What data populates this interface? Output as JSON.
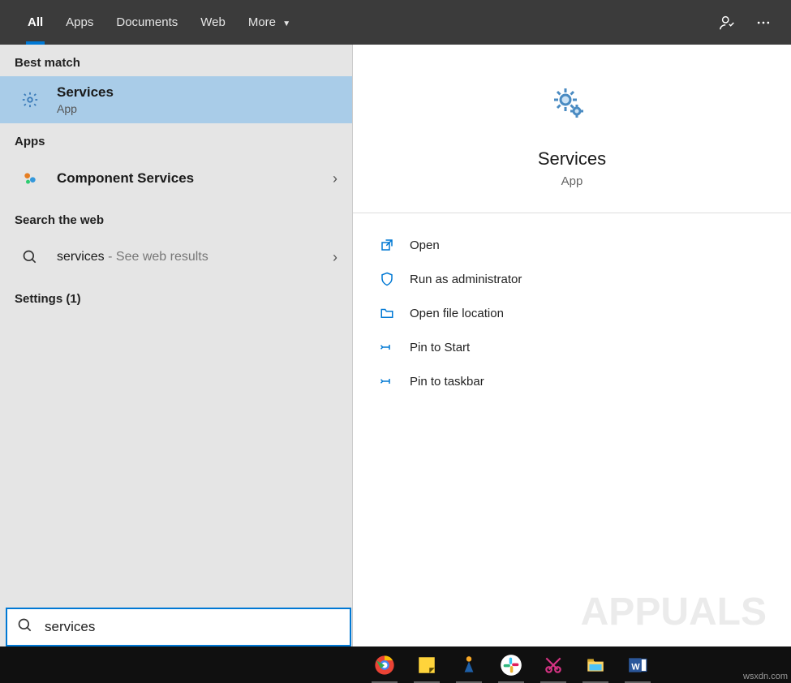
{
  "tabs": {
    "all": "All",
    "apps": "Apps",
    "documents": "Documents",
    "web": "Web",
    "more": "More"
  },
  "left": {
    "best_match_header": "Best match",
    "best_match_title": "Services",
    "best_match_subtitle": "App",
    "apps_header": "Apps",
    "component_prefix": "Component ",
    "component_bold": "Services",
    "web_header": "Search the web",
    "web_query": "services",
    "web_suffix": " - See web results",
    "settings_header": "Settings (1)"
  },
  "preview": {
    "title": "Services",
    "subtitle": "App"
  },
  "actions": {
    "open": "Open",
    "run_admin": "Run as administrator",
    "open_loc": "Open file location",
    "pin_start": "Pin to Start",
    "pin_taskbar": "Pin to taskbar"
  },
  "search": {
    "value": "services"
  },
  "watermark": "APPUALS",
  "wsx": "wsxdn.com"
}
